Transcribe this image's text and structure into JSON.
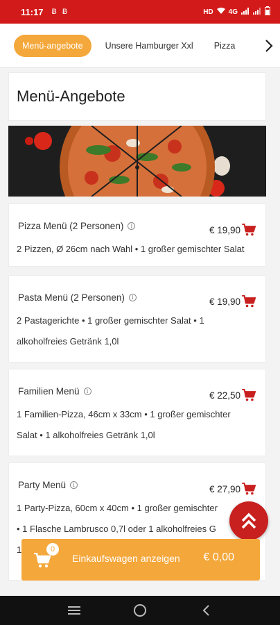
{
  "status_bar": {
    "time": "11:17",
    "left_icons": [
      "sim-b-icon",
      "sim-b-icon"
    ],
    "network": "4G"
  },
  "tabs": {
    "items": [
      {
        "label": "Menü-angebote",
        "active": true
      },
      {
        "label": "Unsere Hamburger Xxl",
        "active": false
      },
      {
        "label": "Pizza",
        "active": false
      }
    ]
  },
  "section": {
    "title": "Menü-Angebote"
  },
  "items": [
    {
      "name": "Pizza Menü (2 Personen)",
      "price": "€ 19,90",
      "desc": [
        "2 Pizzen, Ø 26cm nach Wahl • 1 großer gemischter Salat"
      ]
    },
    {
      "name": "Pasta Menü (2 Personen)",
      "price": "€ 19,90",
      "desc": [
        "2 Pastagerichte • 1 großer gemischter Salat • 1",
        "alkoholfreies Getränk 1,0l"
      ]
    },
    {
      "name": "Familien Menü",
      "price": "€ 22,50",
      "desc": [
        "1 Familien-Pizza, 46cm x 33cm • 1 großer gemischter",
        "Salat • 1 alkoholfreies Getränk 1,0l"
      ]
    },
    {
      "name": "Party Menü",
      "price": "€ 27,90",
      "desc": [
        "1 Party-Pizza, 60cm x 40cm • 1 großer gemischter",
        "• 1 Flasche Lambrusco 0,7l oder 1 alkoholfreies G",
        "1"
      ]
    }
  ],
  "cart_bar": {
    "count": "0",
    "label": "Einkaufswagen anzeigen",
    "total": "€ 0,00"
  },
  "colors": {
    "brand_red": "#d31a1a",
    "accent_orange": "#f4a73a",
    "cart_red": "#c8201f"
  }
}
